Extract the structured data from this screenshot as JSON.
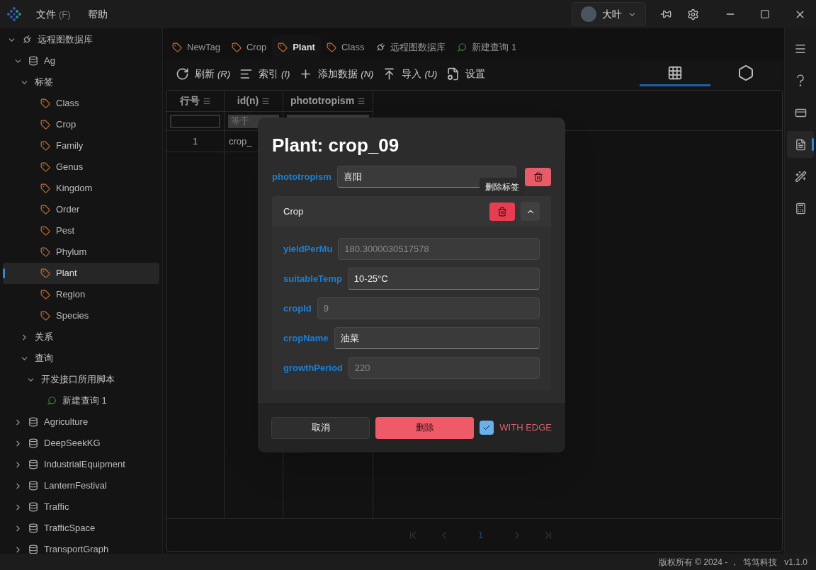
{
  "menu": [
    {
      "label": "文件",
      "accel": "(F)"
    },
    {
      "label": "帮助"
    }
  ],
  "user": {
    "name": "大叶"
  },
  "tree": [
    {
      "kind": "connection",
      "label": "远程图数据库",
      "expanded": true,
      "children": [
        {
          "kind": "db",
          "label": "Ag",
          "expanded": true,
          "children": [
            {
              "kind": "group",
              "label": "标签",
              "expanded": true,
              "children": [
                {
                  "kind": "tag",
                  "label": "Class",
                  "selected": false
                },
                {
                  "kind": "tag",
                  "label": "Crop",
                  "selected": false
                },
                {
                  "kind": "tag",
                  "label": "Family",
                  "selected": false
                },
                {
                  "kind": "tag",
                  "label": "Genus",
                  "selected": false
                },
                {
                  "kind": "tag",
                  "label": "Kingdom",
                  "selected": false
                },
                {
                  "kind": "tag",
                  "label": "Order",
                  "selected": false
                },
                {
                  "kind": "tag",
                  "label": "Pest",
                  "selected": false
                },
                {
                  "kind": "tag",
                  "label": "Phylum",
                  "selected": false
                },
                {
                  "kind": "tag",
                  "label": "Plant",
                  "selected": true
                },
                {
                  "kind": "tag",
                  "label": "Region",
                  "selected": false
                },
                {
                  "kind": "tag",
                  "label": "Species",
                  "selected": false
                }
              ]
            },
            {
              "kind": "group",
              "label": "关系",
              "expanded": false
            },
            {
              "kind": "group",
              "label": "查询",
              "expanded": true,
              "children": [
                {
                  "kind": "group",
                  "label": "开发接口所用脚本",
                  "expanded": true,
                  "children": [
                    {
                      "kind": "query",
                      "label": "新建查询 1",
                      "selected": false
                    }
                  ]
                }
              ]
            }
          ]
        },
        {
          "kind": "db",
          "label": "Agriculture",
          "expanded": false
        },
        {
          "kind": "db",
          "label": "DeepSeekKG",
          "expanded": false
        },
        {
          "kind": "db",
          "label": "IndustrialEquipment",
          "expanded": false
        },
        {
          "kind": "db",
          "label": "LanternFestival",
          "expanded": false
        },
        {
          "kind": "db",
          "label": "Traffic",
          "expanded": false
        },
        {
          "kind": "db",
          "label": "TrafficSpace",
          "expanded": false
        },
        {
          "kind": "db",
          "label": "TransportGraph",
          "expanded": false
        }
      ]
    }
  ],
  "tabs": [
    {
      "kind": "tag",
      "label": "NewTag",
      "selected": false
    },
    {
      "kind": "tag",
      "label": "Crop",
      "selected": false
    },
    {
      "kind": "tag",
      "label": "Plant",
      "selected": true
    },
    {
      "kind": "tag",
      "label": "Class",
      "selected": false
    },
    {
      "kind": "connection",
      "label": "远程图数据库",
      "selected": false
    },
    {
      "kind": "query",
      "label": "新建查询 1",
      "selected": false
    }
  ],
  "toolbar": [
    {
      "kind": "refresh",
      "label": "刷新",
      "accel": "(R)"
    },
    {
      "kind": "index",
      "label": "索引",
      "accel": "(I)"
    },
    {
      "kind": "add",
      "label": "添加数据",
      "accel": "(N)"
    },
    {
      "kind": "import",
      "label": "导入",
      "accel": "(U)"
    },
    {
      "kind": "settings",
      "label": "设置"
    }
  ],
  "views": [
    {
      "kind": "grid",
      "selected": true
    },
    {
      "kind": "graph",
      "selected": false
    }
  ],
  "table": {
    "columns": [
      "行号",
      "id(n)",
      "phototropism"
    ],
    "filters": [
      {
        "kind": "blank"
      },
      {
        "kind": "condition",
        "placeholder": "等于"
      },
      {
        "kind": "condition"
      }
    ],
    "rows": [
      [
        "1",
        "crop_"
      ]
    ]
  },
  "pagination": {
    "page": "1"
  },
  "dialog": {
    "title": "Plant: crop_09",
    "fields": [
      {
        "label": "phototropism",
        "value": "喜阳",
        "disabled": false
      }
    ],
    "tooltip": "删除标签",
    "section": {
      "title": "Crop",
      "expanded": true,
      "fields": [
        {
          "label": "yieldPerMu",
          "value": "180.3000030517578",
          "disabled": true
        },
        {
          "label": "suitableTemp",
          "value": "10-25°C",
          "disabled": false
        },
        {
          "label": "cropId",
          "value": "9",
          "disabled": true
        },
        {
          "label": "cropName",
          "value": "油菜",
          "disabled": false
        },
        {
          "label": "growthPeriod",
          "value": "220",
          "disabled": true
        }
      ]
    },
    "cancel": "取消",
    "delete": "删除",
    "with_edge": {
      "label": "WITH EDGE",
      "checked": true
    }
  },
  "rail": [
    {
      "kind": "menu",
      "selected": false
    },
    {
      "kind": "help",
      "selected": false
    },
    {
      "kind": "card",
      "selected": false
    },
    {
      "kind": "doc",
      "selected": true
    },
    {
      "kind": "wand",
      "selected": false
    },
    {
      "kind": "calc",
      "selected": false
    }
  ],
  "status": {
    "copyright": "版权所有 © 2024 - ，  笃笃科技",
    "version": "v1.1.0"
  }
}
